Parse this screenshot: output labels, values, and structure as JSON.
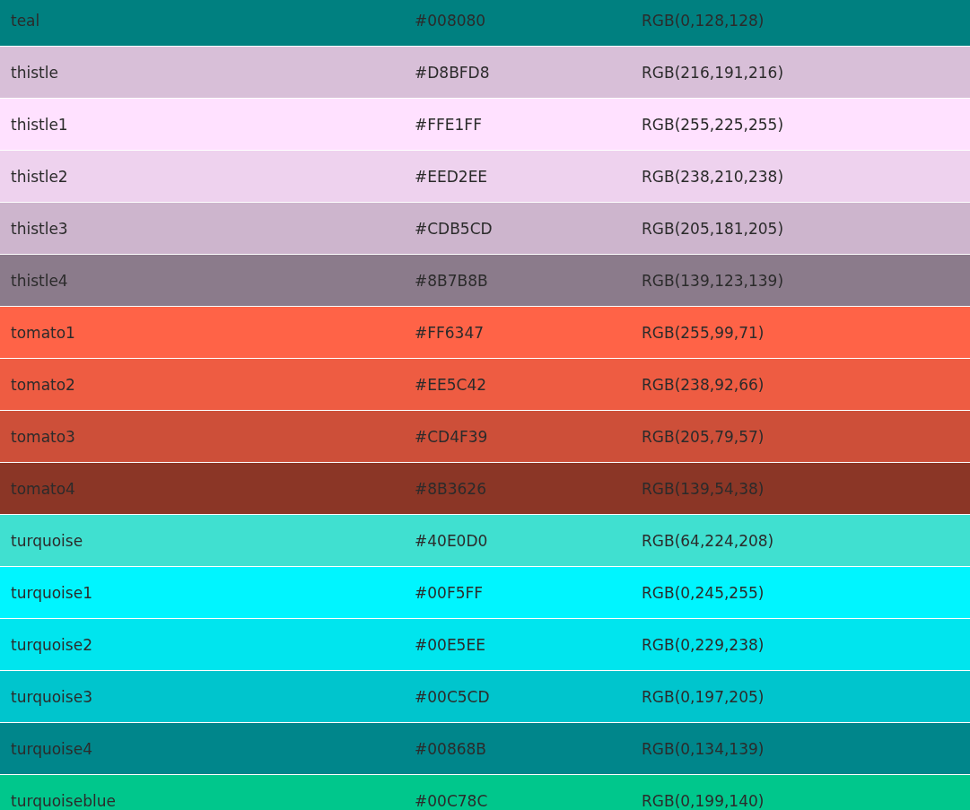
{
  "rows": [
    {
      "name": "teal",
      "hex": "#008080",
      "rgb": "RGB(0,128,128)",
      "color": "#008080"
    },
    {
      "name": "thistle",
      "hex": "#D8BFD8",
      "rgb": "RGB(216,191,216)",
      "color": "#d8bfd8"
    },
    {
      "name": "thistle1",
      "hex": "#FFE1FF",
      "rgb": "RGB(255,225,255)",
      "color": "#ffe1ff"
    },
    {
      "name": "thistle2",
      "hex": "#EED2EE",
      "rgb": "RGB(238,210,238)",
      "color": "#eed2ee"
    },
    {
      "name": "thistle3",
      "hex": "#CDB5CD",
      "rgb": "RGB(205,181,205)",
      "color": "#cdb5cd"
    },
    {
      "name": "thistle4",
      "hex": "#8B7B8B",
      "rgb": "RGB(139,123,139)",
      "color": "#8b7b8b"
    },
    {
      "name": "tomato1",
      "hex": "#FF6347",
      "rgb": "RGB(255,99,71)",
      "color": "#ff6347"
    },
    {
      "name": "tomato2",
      "hex": "#EE5C42",
      "rgb": "RGB(238,92,66)",
      "color": "#ee5c42"
    },
    {
      "name": "tomato3",
      "hex": "#CD4F39",
      "rgb": "RGB(205,79,57)",
      "color": "#cd4f39"
    },
    {
      "name": "tomato4",
      "hex": "#8B3626",
      "rgb": "RGB(139,54,38)",
      "color": "#8b3626"
    },
    {
      "name": "turquoise",
      "hex": "#40E0D0",
      "rgb": "RGB(64,224,208)",
      "color": "#40e0d0"
    },
    {
      "name": "turquoise1",
      "hex": "#00F5FF",
      "rgb": "RGB(0,245,255)",
      "color": "#00f5ff"
    },
    {
      "name": "turquoise2",
      "hex": "#00E5EE",
      "rgb": "RGB(0,229,238)",
      "color": "#00e5ee"
    },
    {
      "name": "turquoise3",
      "hex": "#00C5CD",
      "rgb": "RGB(0,197,205)",
      "color": "#00c5cd"
    },
    {
      "name": "turquoise4",
      "hex": "#00868B",
      "rgb": "RGB(0,134,139)",
      "color": "#00868b"
    },
    {
      "name": "turquoiseblue",
      "hex": "#00C78C",
      "rgb": "RGB(0,199,140)",
      "color": "#00c78c"
    }
  ]
}
